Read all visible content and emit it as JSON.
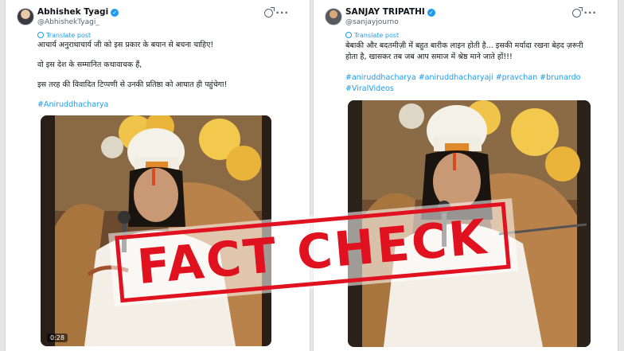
{
  "left_post": {
    "author_name": "Abhishek Tyagi",
    "verified_mark": "✓",
    "handle": "@AbhishekTyagi_",
    "translate_label": "Translate post",
    "lines": [
      "आचार्य अनुराधाचार्य जी को इस प्रकार के बयान से बचना चाहिए!",
      "वो इस देश के सम्मानित कथावाचक हैं,",
      "इस तरह की विवादित टिप्पणी से उनकी प्रतिष्ठा को आघात ही पहुंचेगा!"
    ],
    "hashtags": "#Aniruddhacharya",
    "video_time": "0:28"
  },
  "right_post": {
    "author_name": "SANJAY TRIPATHI",
    "verified_mark": "✓",
    "handle": "@sanjayjourno",
    "translate_label": "Translate post",
    "lines": [
      "बेबाकी और बदतमीज़ी में बहुत बारीक लाइन होती है... इसकी मर्यादा रखना बेहद ज़रूरी",
      "होता है, खासकर तब जब आप समाज में श्रेष्ठ माने जाते हों!!!"
    ],
    "hashtags_line1": "#aniruddhacharya #aniruddhacharyaji #pravchan #brunardo",
    "hashtags_line2": "#ViralVideos"
  },
  "overlay": {
    "stamp_text": "FACT CHECK"
  },
  "icons": {
    "grok": "grok-icon",
    "more": "more-options-icon",
    "translate": "globe-icon"
  },
  "colors": {
    "link": "#1d9bf0",
    "stamp_red": "#e0121f",
    "text": "#0f1419",
    "muted": "#536471"
  }
}
